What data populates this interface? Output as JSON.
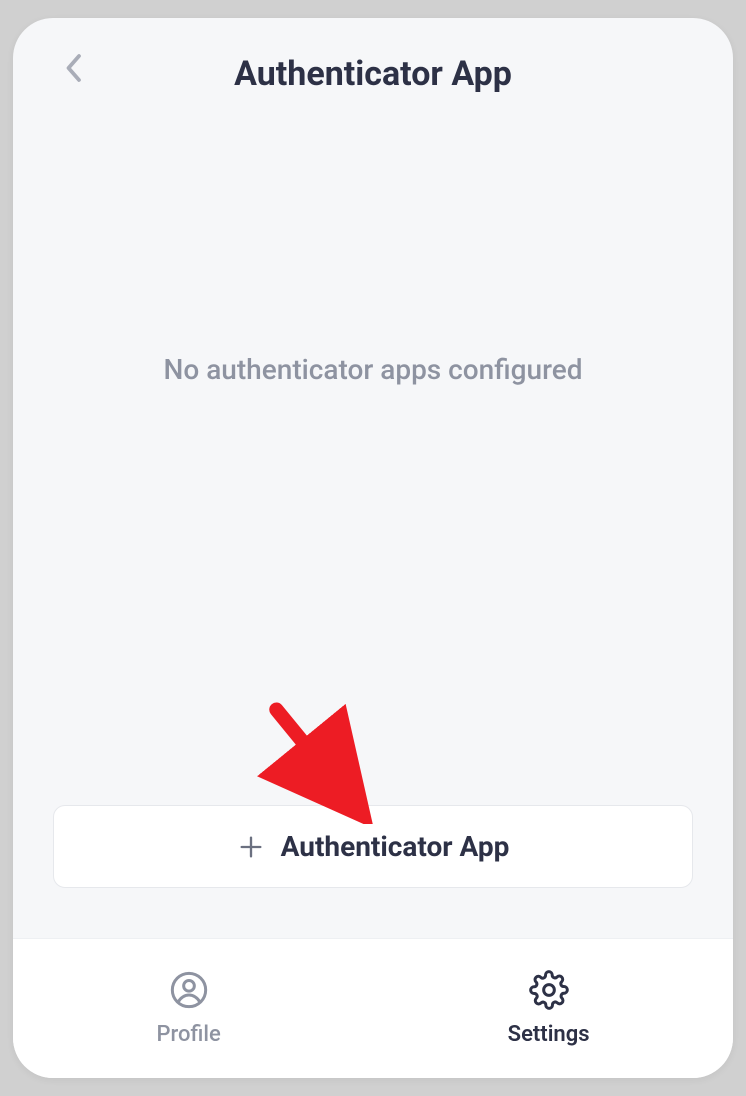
{
  "header": {
    "title": "Authenticator App"
  },
  "main": {
    "empty_message": "No authenticator apps configured",
    "add_button_label": "Authenticator App"
  },
  "nav": {
    "profile_label": "Profile",
    "settings_label": "Settings"
  },
  "annotation": {
    "arrow_color": "#ed1c24"
  }
}
